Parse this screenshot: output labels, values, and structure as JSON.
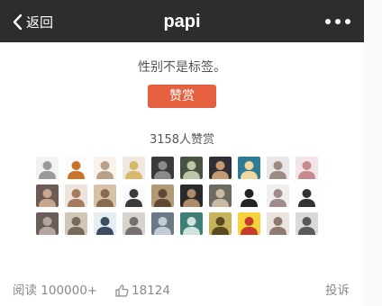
{
  "nav": {
    "back_label": "返回",
    "title": "papi"
  },
  "reward": {
    "slogan": "性别不是标签。",
    "button_label": "赞赏",
    "count_label": "3158人赞赏"
  },
  "avatars": [
    {
      "bg": "#f2f2f2",
      "fg": "#9a9a9a"
    },
    {
      "bg": "#fbfbfb",
      "fg": "#c9742a"
    },
    {
      "bg": "#f7f2ec",
      "fg": "#b9a08a"
    },
    {
      "bg": "#efe7e0",
      "fg": "#d8b86a"
    },
    {
      "bg": "#3a3a3a",
      "fg": "#8a8a8a"
    },
    {
      "bg": "#485441",
      "fg": "#bcc6a9"
    },
    {
      "bg": "#2f2f36",
      "fg": "#c89a72"
    },
    {
      "bg": "#2f7a95",
      "fg": "#f0d9a0"
    },
    {
      "bg": "#e8e6e6",
      "fg": "#9c8a84"
    },
    {
      "bg": "#f3e4e6",
      "fg": "#c78a8e"
    },
    {
      "bg": "#6d5c53",
      "fg": "#c9a690"
    },
    {
      "bg": "#ede4dc",
      "fg": "#a57b5f"
    },
    {
      "bg": "#d7c2a9",
      "fg": "#8a6a4e"
    },
    {
      "bg": "#fafafa",
      "fg": "#3a3a3a"
    },
    {
      "bg": "#b39a76",
      "fg": "#5d4a34"
    },
    {
      "bg": "#2a2a2a",
      "fg": "#b08a6c"
    },
    {
      "bg": "#6d6a60",
      "fg": "#c7b9a4"
    },
    {
      "bg": "#fcfcfc",
      "fg": "#222222"
    },
    {
      "bg": "#f1eeee",
      "fg": "#9e8b8b"
    },
    {
      "bg": "#fdfdfd",
      "fg": "#333333"
    },
    {
      "bg": "#6a5e5c",
      "fg": "#b7a3a0"
    },
    {
      "bg": "#cfc7b9",
      "fg": "#7a6a5c"
    },
    {
      "bg": "#e6eef1",
      "fg": "#3c4c62"
    },
    {
      "bg": "#d8d3cf",
      "fg": "#777070"
    },
    {
      "bg": "#6b7887",
      "fg": "#c3ccd4"
    },
    {
      "bg": "#3d7f76",
      "fg": "#cfe3dd"
    },
    {
      "bg": "#c7b35b",
      "fg": "#5c4a1f"
    },
    {
      "bg": "#f4d23a",
      "fg": "#c73b2b"
    },
    {
      "bg": "#e9e4df",
      "fg": "#8e7b6d"
    },
    {
      "bg": "#d9d9d9",
      "fg": "#5a5a5a"
    }
  ],
  "footer": {
    "reads_label": "阅读 100000+",
    "likes_count": "18124",
    "report_label": "投诉"
  },
  "colors": {
    "navbar": "#2d2d2d",
    "accent": "#e5603f"
  }
}
